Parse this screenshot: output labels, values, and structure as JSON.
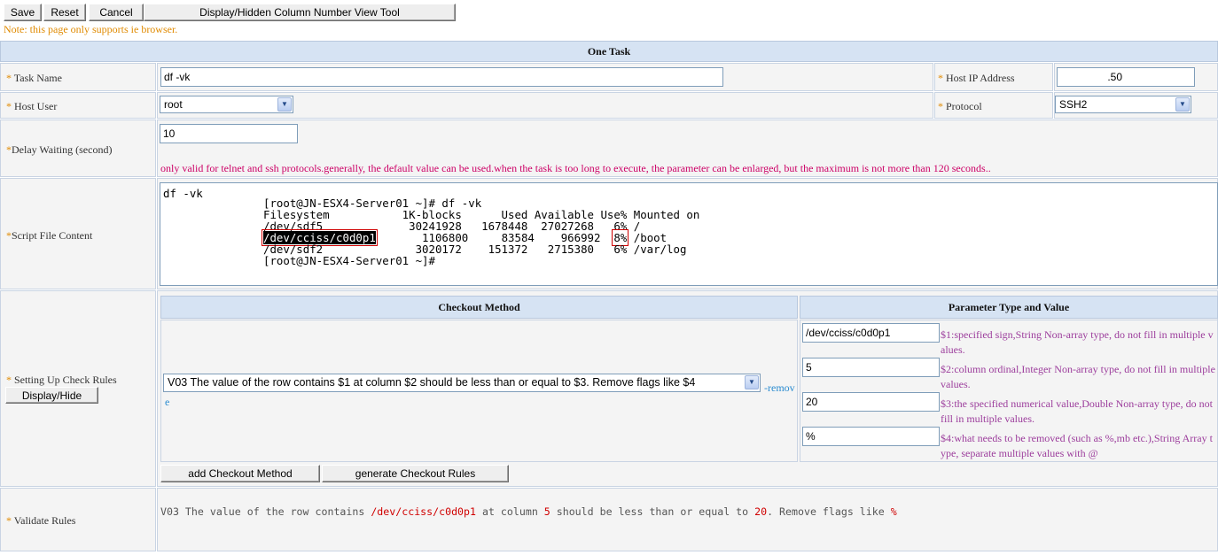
{
  "toolbar": {
    "save": "Save",
    "reset": "Reset",
    "cancel": "Cancel",
    "column_tool": "Display/Hidden Column Number View Tool"
  },
  "note": "Note: this page only supports ie browser.",
  "section_title": "One Task",
  "fields": {
    "task_name": {
      "label": "Task Name",
      "value": "df -vk"
    },
    "host_ip": {
      "label": "Host IP Address",
      "value": "                .50"
    },
    "host_user": {
      "label": "Host User",
      "value": "root"
    },
    "protocol": {
      "label": "Protocol",
      "value": "SSH2"
    },
    "delay": {
      "label": "Delay Waiting (second)",
      "value": "10",
      "hint": "only valid for telnet and ssh protocols.generally, the default value can be used.when the task is too long to execute, the parameter can be enlarged, but the maximum is not more than 120 seconds.."
    },
    "script": {
      "label": "Script File Content",
      "line0": "df -vk",
      "line1": "[root@JN-ESX4-Server01 ~]# df -vk",
      "line2": "Filesystem           1K-blocks      Used Available Use% Mounted on",
      "line3": "/dev/sdf5             30241928   1678448  27027268   6% /",
      "line4_dev": "/dev/cciss/c0d0p1",
      "line4_mid": "       1106800     83584    966992  ",
      "line4_pct": "8%",
      "line4_end": " /boot",
      "line5": "/dev/sdf2              3020172    151372   2715380   6% /var/log",
      "line6": "[root@JN-ESX4-Server01 ~]#"
    }
  },
  "check_rules": {
    "label": "Setting Up Check Rules",
    "toggle": "Display/Hide",
    "method_header": "Checkout Method",
    "param_header": "Parameter Type and Value",
    "method_value": "V03 The value of the row contains $1 at column $2 should be less than or equal to $3. Remove flags like $4",
    "remove_link_a": "-remov",
    "remove_link_b": "e",
    "params": [
      {
        "value": "/dev/cciss/c0d0p1",
        "desc": "$1:specified sign,String Non-array type, do not fill in multiple values."
      },
      {
        "value": "5",
        "desc": "$2:column ordinal,Integer Non-array type, do not fill in multiple values."
      },
      {
        "value": "20",
        "desc": "$3:the specified numerical value,Double Non-array type, do not fill in multiple values."
      },
      {
        "value": "%",
        "desc": "$4:what needs to be removed (such as %,mb etc.),String Array type, separate multiple values with @"
      }
    ],
    "add_button": "add Checkout Method",
    "generate_button": "generate Checkout Rules"
  },
  "validate": {
    "label": "Validate Rules",
    "t1": "V03 The value of the row contains ",
    "v1": "/dev/cciss/c0d0p1",
    "t2": " at column ",
    "v2": "5",
    "t3": " should be less than or equal to ",
    "v3": "20",
    "t4": ". Remove flags like ",
    "v4": "%"
  },
  "required_mark": "*"
}
